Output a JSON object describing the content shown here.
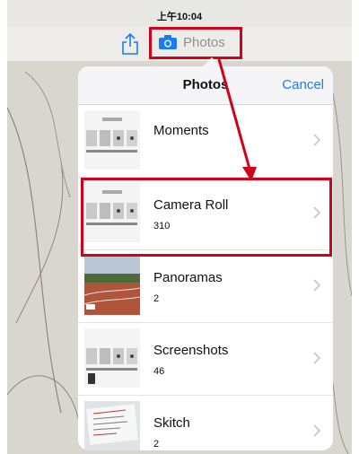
{
  "status_bar": {
    "time": "上午10:04"
  },
  "toolbar": {
    "photos_label": "Photos",
    "share_icon": "share-icon",
    "camera_icon": "camera-icon"
  },
  "popover": {
    "title": "Photos",
    "cancel_label": "Cancel",
    "albums": [
      {
        "name": "Moments",
        "count": "",
        "thumb": "grid"
      },
      {
        "name": "Camera Roll",
        "count": "310",
        "thumb": "grid"
      },
      {
        "name": "Panoramas",
        "count": "2",
        "thumb": "panorama"
      },
      {
        "name": "Screenshots",
        "count": "46",
        "thumb": "grid"
      },
      {
        "name": "Skitch",
        "count": "2",
        "thumb": "whiteboard"
      }
    ]
  },
  "colors": {
    "annotation_red": "#d0021b",
    "link_blue": "#1a7cf5"
  }
}
